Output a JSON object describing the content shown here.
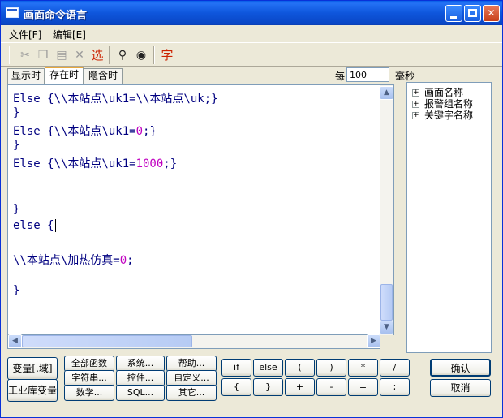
{
  "window": {
    "title": "画面命令语言"
  },
  "menu": [
    {
      "label": "文件[F]"
    },
    {
      "label": "编辑[E]"
    }
  ],
  "toolbar": {
    "icons": [
      "cut-icon",
      "copy-icon",
      "paste-icon",
      "delete-icon",
      "select-icon",
      "find-icon",
      "replace-icon",
      "font-icon"
    ],
    "select_glyph": "选",
    "font_glyph": "字"
  },
  "tabs": [
    {
      "label": "显示时"
    },
    {
      "label": "存在时"
    },
    {
      "label": "隐含时"
    }
  ],
  "interval": {
    "prefix": "每",
    "value": "100",
    "unit": "毫秒"
  },
  "code": {
    "lines": [
      {
        "text": "Else {\\\\本站点\\uk1=\\\\本站点\\uk;}",
        "num": ""
      },
      {
        "text": "}",
        "num": ""
      },
      {
        "text": "Else {\\\\本站点\\uk1=",
        "num": "0",
        "tail": ";}"
      },
      {
        "text": "}",
        "num": ""
      },
      {
        "text": "Else {\\\\本站点\\uk1=",
        "num": "1000",
        "tail": ";}"
      },
      {
        "text": "}",
        "num": ""
      },
      {
        "text": "else {",
        "num": ""
      },
      {
        "text": "\\\\本站点\\加热仿真=",
        "num": "0",
        "tail": ";"
      },
      {
        "text": "}",
        "num": ""
      }
    ]
  },
  "tree": [
    {
      "label": "画面名称"
    },
    {
      "label": "报警组名称"
    },
    {
      "label": "关键字名称"
    }
  ],
  "left_buttons": [
    {
      "label": "变量[.域]"
    },
    {
      "label": "工业库变量"
    }
  ],
  "function_buttons": [
    {
      "label": "全部函数"
    },
    {
      "label": "系统..."
    },
    {
      "label": "帮助..."
    },
    {
      "label": "字符串..."
    },
    {
      "label": "控件..."
    },
    {
      "label": "自定义..."
    },
    {
      "label": "数学..."
    },
    {
      "label": "SQL..."
    },
    {
      "label": "其它..."
    }
  ],
  "operator_buttons": [
    {
      "label": "if"
    },
    {
      "label": "else"
    },
    {
      "label": "("
    },
    {
      "label": ")"
    },
    {
      "label": "*"
    },
    {
      "label": "/"
    },
    {
      "label": "{"
    },
    {
      "label": "}"
    },
    {
      "label": "+"
    },
    {
      "label": "-"
    },
    {
      "label": "="
    },
    {
      "label": ";"
    }
  ],
  "actions": {
    "ok": "确认",
    "cancel": "取消"
  }
}
